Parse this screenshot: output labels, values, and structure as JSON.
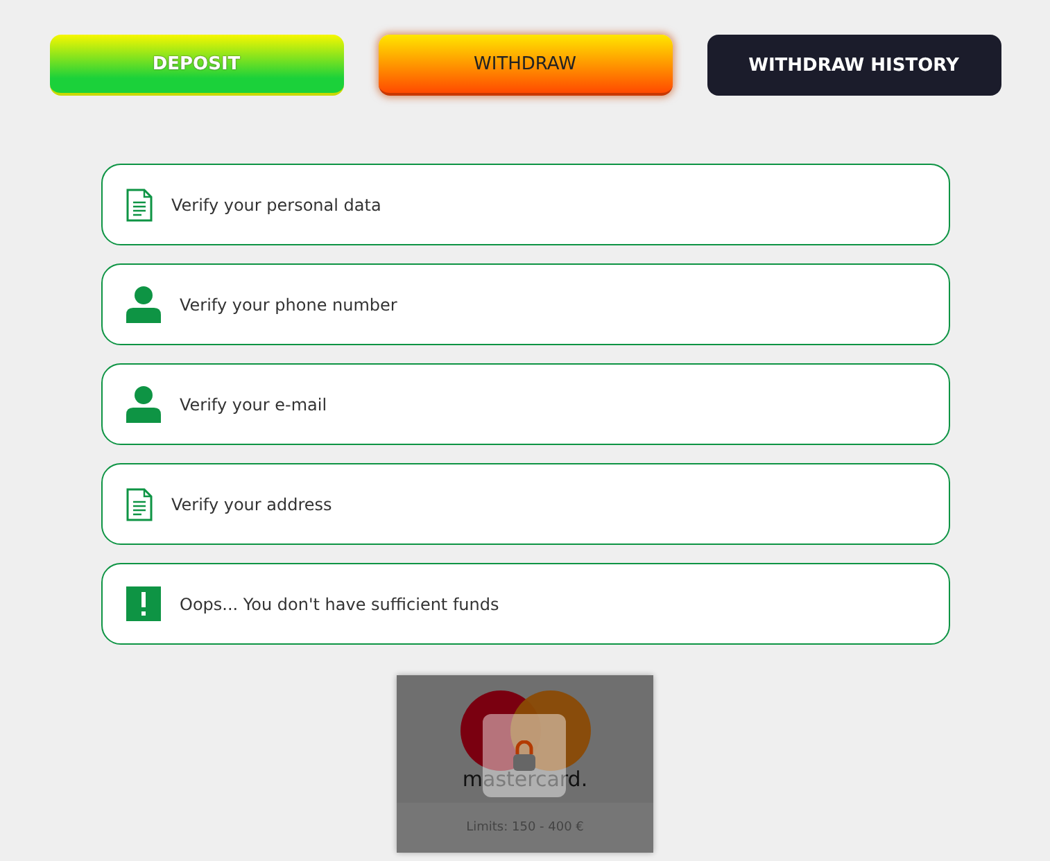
{
  "tabs": [
    {
      "label": "DEPOSIT",
      "kind": "green",
      "selected": false
    },
    {
      "label": "WITHDRAW",
      "kind": "orange",
      "selected": true
    },
    {
      "label": "WITHDRAW HISTORY",
      "kind": "dark",
      "selected": false
    }
  ],
  "steps": [
    {
      "kind": "document",
      "text": "Verify your personal data"
    },
    {
      "kind": "user",
      "text": "Verify your phone number"
    },
    {
      "kind": "user",
      "text": "Verify your e-mail"
    },
    {
      "kind": "document",
      "text": "Verify your address"
    },
    {
      "kind": "alert",
      "text": "Oops... You don't have sufficient funds"
    }
  ],
  "payment_method": {
    "brand": "mastercard.",
    "limits": "Limits: 150 - 400 €",
    "locked": true
  }
}
